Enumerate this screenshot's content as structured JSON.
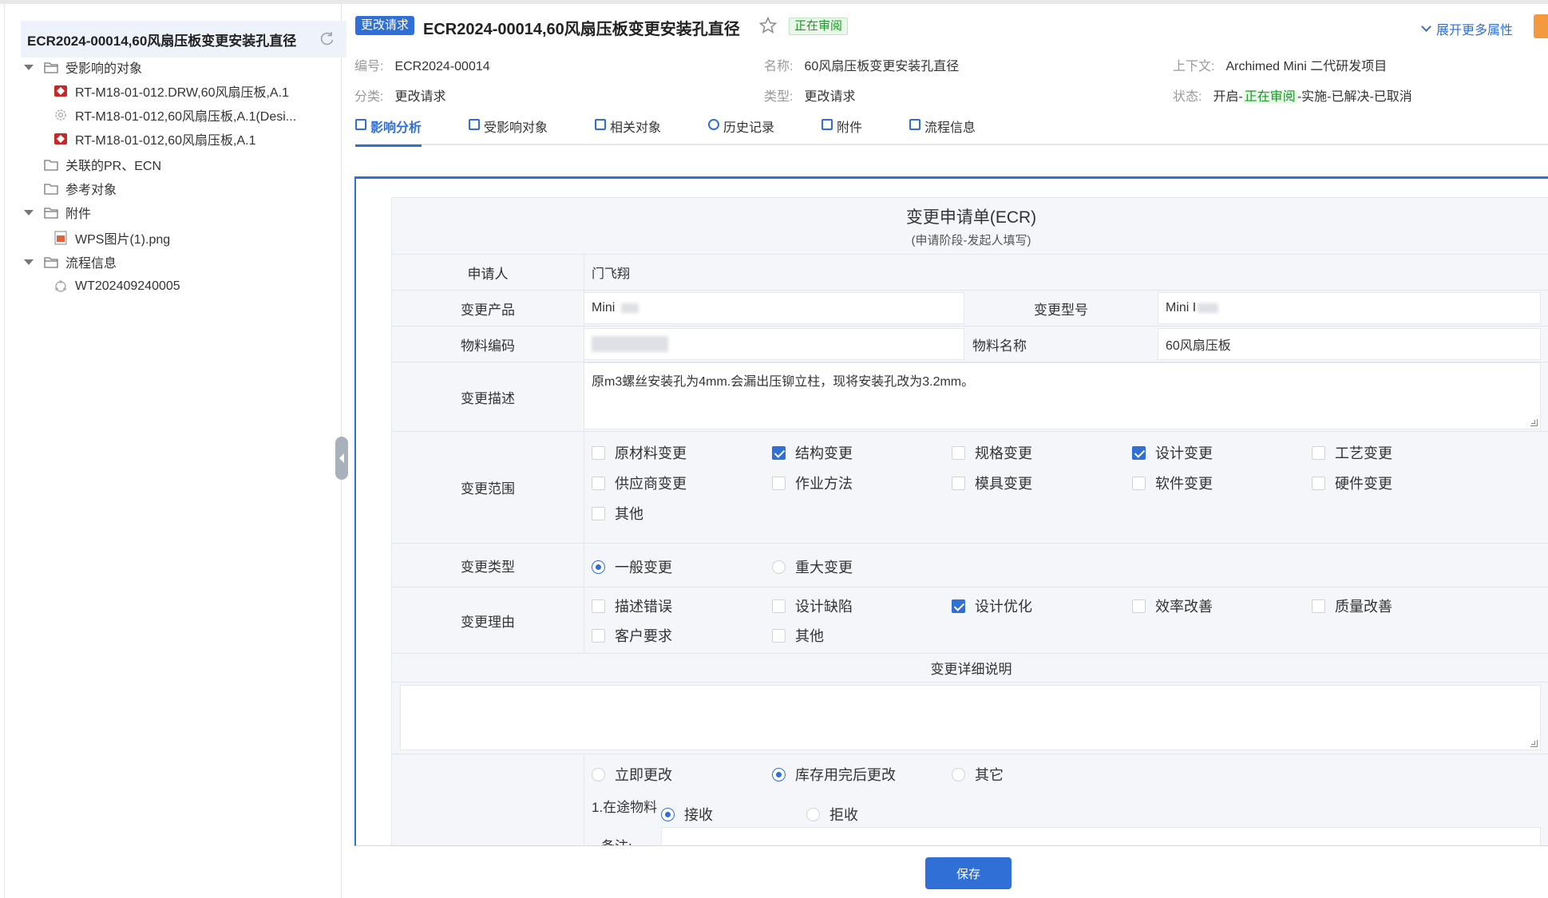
{
  "sidebar": {
    "title": "ECR2024-00014,60风扇压板变更安装孔直径",
    "tree": [
      {
        "label": "受影响的对象"
      },
      {
        "label": "RT-M18-01-012.DRW,60风扇压板,A.1"
      },
      {
        "label": "RT-M18-01-012,60风扇压板,A.1(Desi..."
      },
      {
        "label": "RT-M18-01-012,60风扇压板,A.1"
      },
      {
        "label": "关联的PR、ECN"
      },
      {
        "label": "参考对象"
      },
      {
        "label": "附件"
      },
      {
        "label": "WPS图片(1).png"
      },
      {
        "label": "流程信息"
      },
      {
        "label": "WT202409240005"
      }
    ]
  },
  "header": {
    "badge": "更改请求",
    "title": "ECR2024-00014,60风扇压板变更安装孔直径",
    "state": "正在审阅",
    "expand_more": "展开更多属性"
  },
  "meta": {
    "number_label": "编号:",
    "number": "ECR2024-00014",
    "name_label": "名称:",
    "name": "60风扇压板变更安装孔直径",
    "context_label": "上下文:",
    "context": "Archimed Mini 二代研发项目",
    "category_label": "分类:",
    "category": "更改请求",
    "type_label": "类型:",
    "type": "更改请求",
    "status_label": "状态:",
    "status_prefix": "开启-",
    "status_current": "正在审阅",
    "status_suffix": "-实施-已解决-已取消"
  },
  "tabs": [
    "影响分析",
    "受影响对象",
    "相关对象",
    "历史记录",
    "附件",
    "流程信息"
  ],
  "form": {
    "title": "变更申请单(ECR)",
    "subtitle": "(申请阶段-发起人填写)",
    "applicant_label": "申请人",
    "applicant": "门飞翔",
    "product_label": "变更产品",
    "product": "Mini",
    "model_label": "变更型号",
    "model": "Mini I",
    "material_code_label": "物料编码",
    "material_name_label": "物料名称",
    "material_name": "60风扇压板",
    "desc_label": "变更描述",
    "desc": "原m3螺丝安装孔为4mm.会漏出压铆立柱，现将安装孔改为3.2mm。",
    "scope_label": "变更范围",
    "scope_options": [
      {
        "label": "原材料变更",
        "checked": false
      },
      {
        "label": "结构变更",
        "checked": true
      },
      {
        "label": "规格变更",
        "checked": false
      },
      {
        "label": "设计变更",
        "checked": true
      },
      {
        "label": "工艺变更",
        "checked": false
      },
      {
        "label": "供应商变更",
        "checked": false
      },
      {
        "label": "作业方法",
        "checked": false
      },
      {
        "label": "模具变更",
        "checked": false
      },
      {
        "label": "软件变更",
        "checked": false
      },
      {
        "label": "硬件变更",
        "checked": false
      },
      {
        "label": "其他",
        "checked": false
      }
    ],
    "type_label": "变更类型",
    "type_options": [
      {
        "label": "一般变更",
        "selected": true
      },
      {
        "label": "重大变更",
        "selected": false
      }
    ],
    "reason_label": "变更理由",
    "reason_options": [
      {
        "label": "描述错误",
        "checked": false
      },
      {
        "label": "设计缺陷",
        "checked": false
      },
      {
        "label": "设计优化",
        "checked": true
      },
      {
        "label": "效率改善",
        "checked": false
      },
      {
        "label": "质量改善",
        "checked": false
      },
      {
        "label": "客户要求",
        "checked": false
      },
      {
        "label": "其他",
        "checked": false
      }
    ],
    "detail_label": "变更详细说明",
    "timing_options": [
      {
        "label": "立即更改",
        "selected": false
      },
      {
        "label": "库存用完后更改",
        "selected": true
      },
      {
        "label": "其它",
        "selected": false
      }
    ],
    "in_transit_label": "1.在途物料",
    "in_transit_options": [
      {
        "label": "接收",
        "selected": true
      },
      {
        "label": "拒收",
        "selected": false
      }
    ],
    "remark_label": "备注:"
  },
  "save_label": "保存",
  "colors": {
    "accent": "#2f6fd6",
    "status_green": "#1a9a26",
    "orange": "#f29a3d"
  }
}
